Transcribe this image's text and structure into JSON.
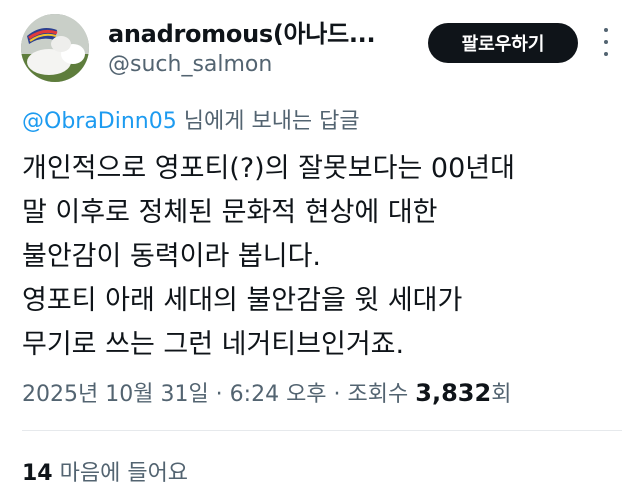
{
  "tweet": {
    "author": {
      "display_name": "anadromous(아나드...",
      "handle": "@such_salmon",
      "avatar": "avatar-image"
    },
    "follow_label": "팔로우하기",
    "more_icon": "more-vertical-icon",
    "reply_to": {
      "mention": "@ObraDinn05",
      "suffix": " 님에게 보내는 답글"
    },
    "body_lines": [
      "개인적으로 영포티(?)의 잘못보다는 00년대",
      "말 이후로 정체된 문화적 현상에 대한",
      "불안감이 동력이라 봅니다.",
      "영포티 아래 세대의 불안감을 윗 세대가",
      "무기로 쓰는 그런 네거티브인거죠."
    ],
    "meta": {
      "date": "2025년 10월 31일",
      "sep1": " · ",
      "time": "6:24 오후",
      "sep2": " · ",
      "views_label": "조회수 ",
      "views_count": "3,832",
      "views_suffix": "회"
    },
    "likes": {
      "count": "14",
      "label": " 마음에 들어요"
    }
  },
  "colors": {
    "accent": "#1d9bf0",
    "text": "#0f1419",
    "secondary": "#536471",
    "button_bg": "#0f1419"
  }
}
